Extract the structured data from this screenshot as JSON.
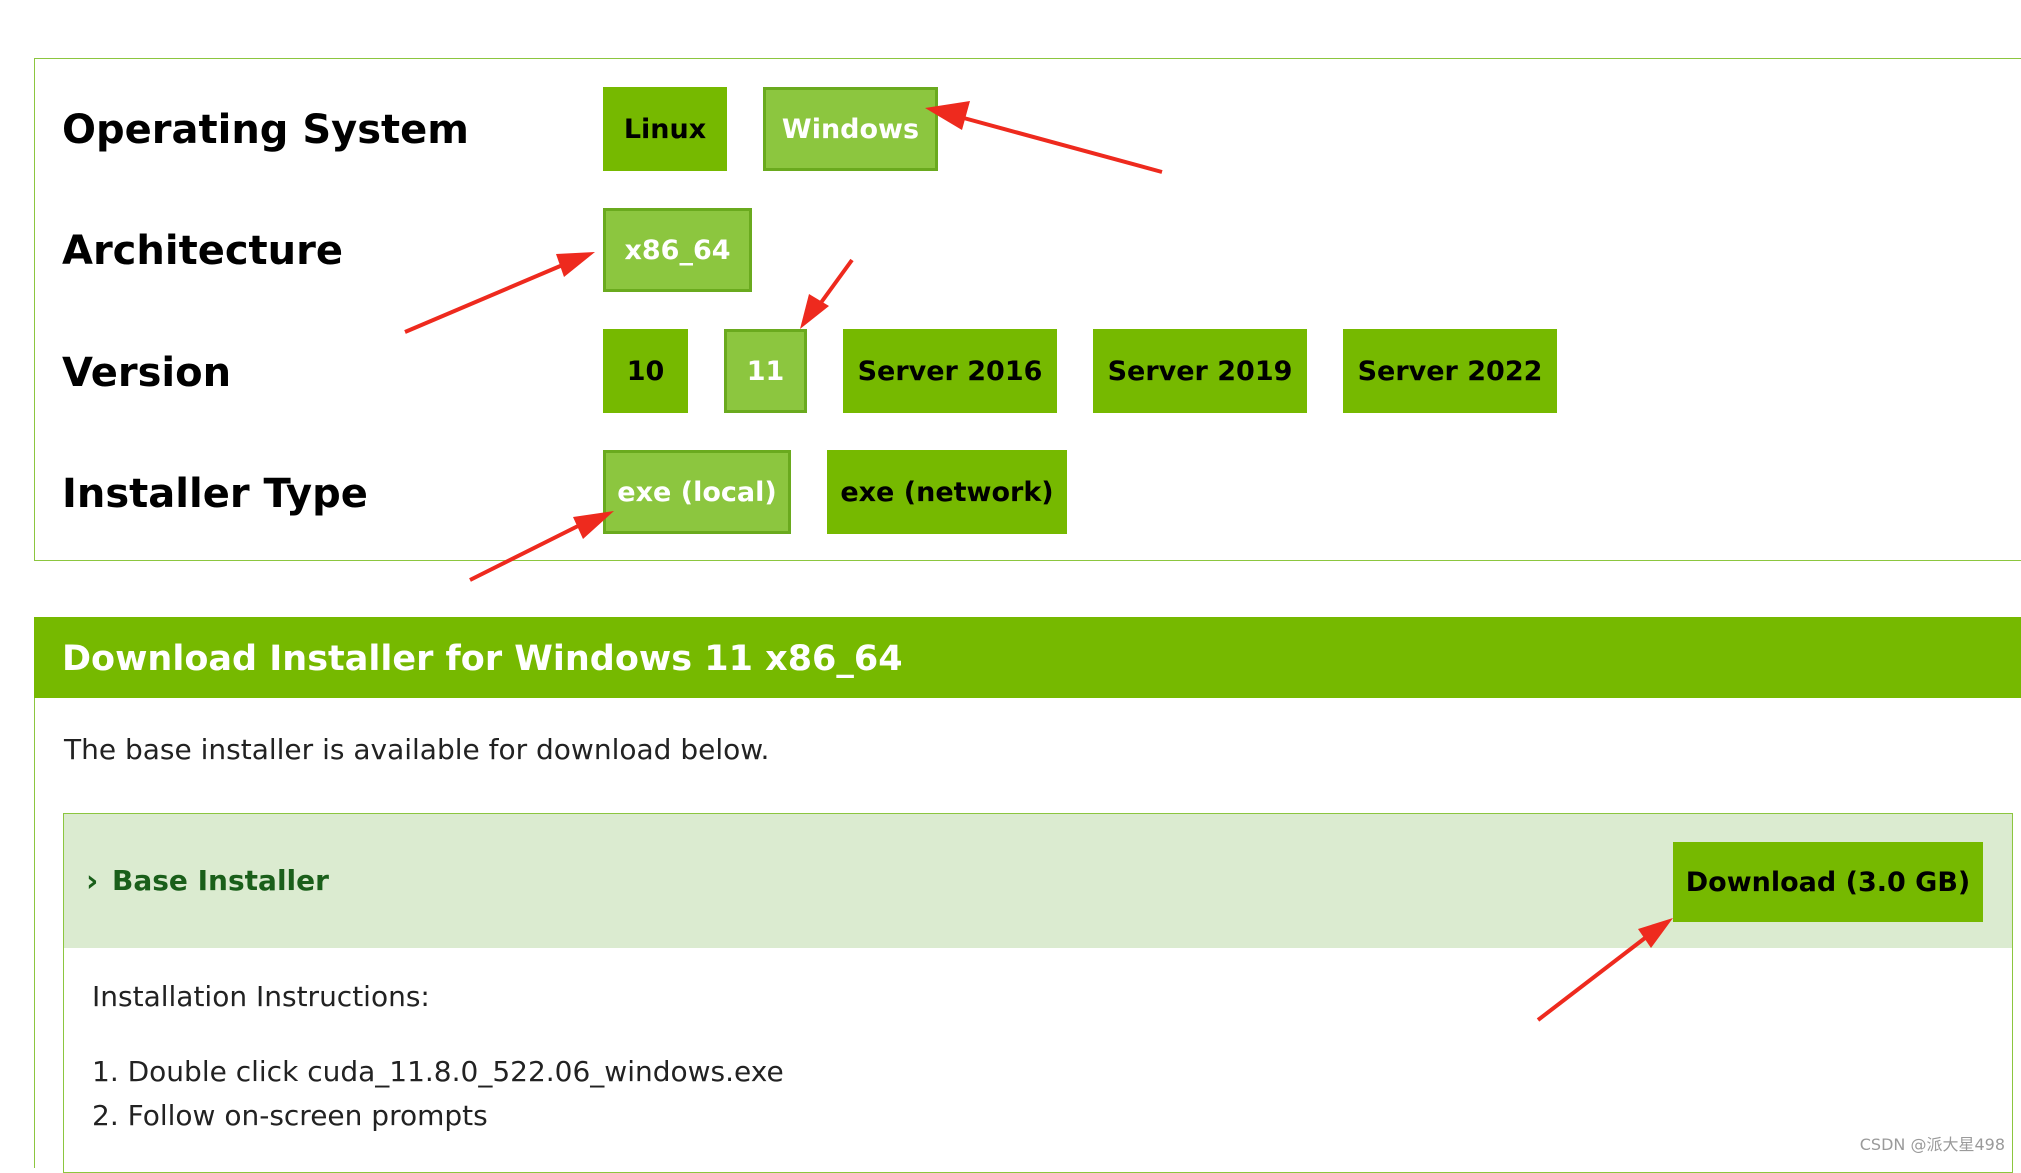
{
  "selector": {
    "rows": [
      {
        "label": "Operating System",
        "options": [
          "Linux",
          "Windows"
        ]
      },
      {
        "label": "Architecture",
        "options": [
          "x86_64"
        ]
      },
      {
        "label": "Version",
        "options": [
          "10",
          "11",
          "Server 2016",
          "Server 2019",
          "Server 2022"
        ]
      },
      {
        "label": "Installer Type",
        "options": [
          "exe (local)",
          "exe (network)"
        ]
      }
    ],
    "selected": {
      "os": "Windows",
      "arch": "x86_64",
      "version": "11",
      "installer": "exe (local)"
    }
  },
  "download": {
    "header": "Download Installer for Windows 11 x86_64",
    "intro": "The base installer is available for download below.",
    "installer_title": "Base Installer",
    "button_label": "Download (3.0 GB)",
    "instructions_title": "Installation Instructions:",
    "steps": [
      "1. Double click cuda_11.8.0_522.06_windows.exe",
      "2. Follow on-screen prompts"
    ]
  },
  "watermark": "CSDN @派大星498",
  "colors": {
    "nvidia_green": "#76b900",
    "selected_green": "#8cc63f",
    "annotation_red": "#ee2a1e"
  }
}
